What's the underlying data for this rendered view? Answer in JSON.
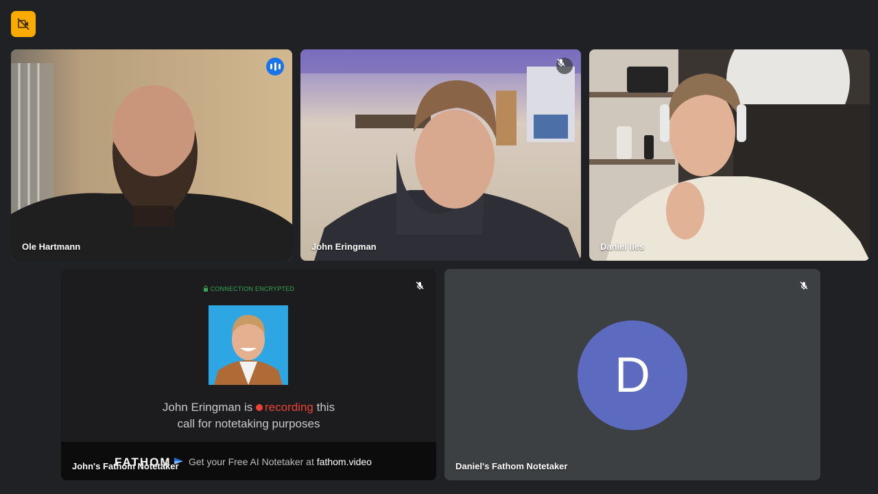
{
  "participants": [
    {
      "name": "Ole Hartmann",
      "state": "speaking"
    },
    {
      "name": "John Eringman",
      "state": "muted"
    },
    {
      "name": "Daniel Iles",
      "state": "muted"
    }
  ],
  "fathom_tile": {
    "name": "John's Fathom Notetaker",
    "encryption": "CONNECTION ENCRYPTED",
    "line1_prefix": "John Eringman is",
    "line1_recording": "recording",
    "line1_suffix": "this",
    "line2": "call for notetaking purposes",
    "logo": "FATHOM",
    "cta_prefix": "Get your Free AI Notetaker at",
    "cta_link": "fathom.video"
  },
  "avatar_tile": {
    "name": "Daniel's Fathom Notetaker",
    "initial": "D"
  },
  "icons": {
    "top_badge": "no-camera-icon",
    "mute": "mic-off-icon",
    "speaking": "audio-level-icon",
    "lock": "lock-icon"
  },
  "colors": {
    "accent": "#1a73e8",
    "badge": "#f9ab00",
    "active_outline": "#8ab4f8",
    "recording": "#ea4335",
    "encrypted": "#34a853",
    "avatar": "#5c6bc0"
  }
}
